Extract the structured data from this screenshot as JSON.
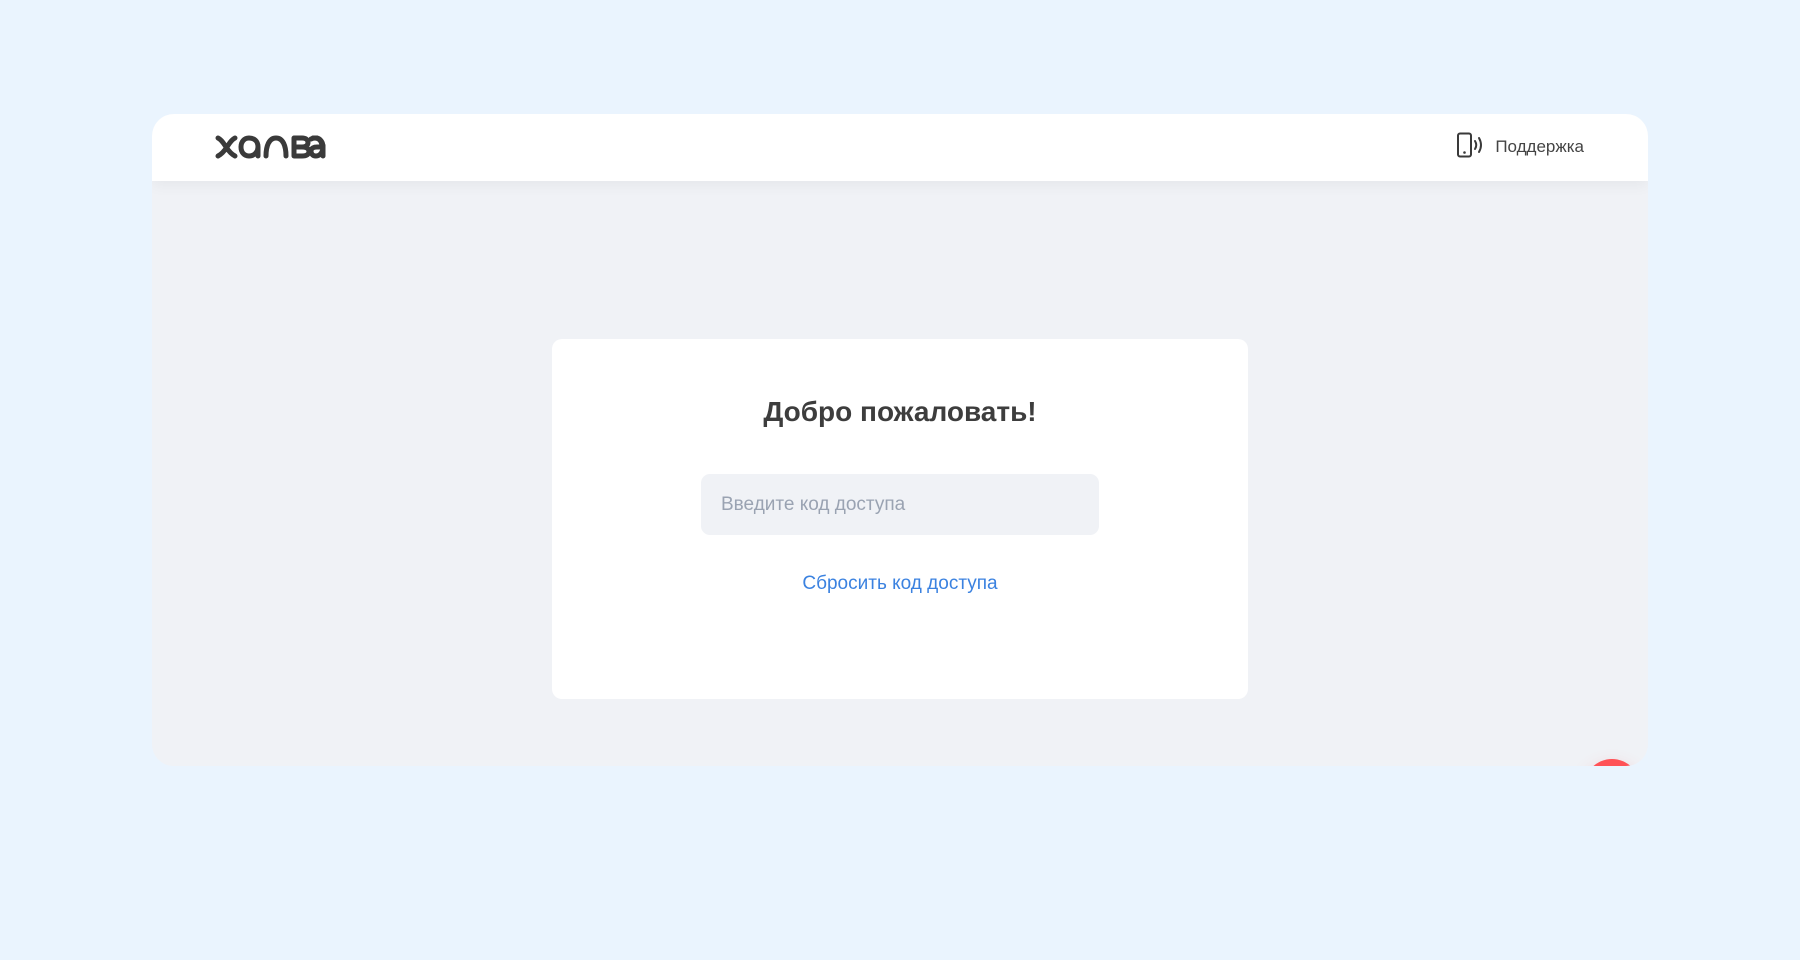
{
  "header": {
    "logo_alt": "халва",
    "support_label": "Поддержка"
  },
  "login_card": {
    "title": "Добро пожаловать!",
    "code_input_placeholder": "Введите код доступа",
    "code_input_value": "",
    "reset_link_label": "Сбросить код доступа"
  },
  "icons": {
    "support": "phone-signal-icon",
    "chat": "chat-bubble-icon"
  },
  "colors": {
    "page_background": "#eaf4fe",
    "content_background": "#f0f2f6",
    "title_text": "#3d3d3d",
    "link": "#3b82e0",
    "chat_button": "#ff5257"
  }
}
